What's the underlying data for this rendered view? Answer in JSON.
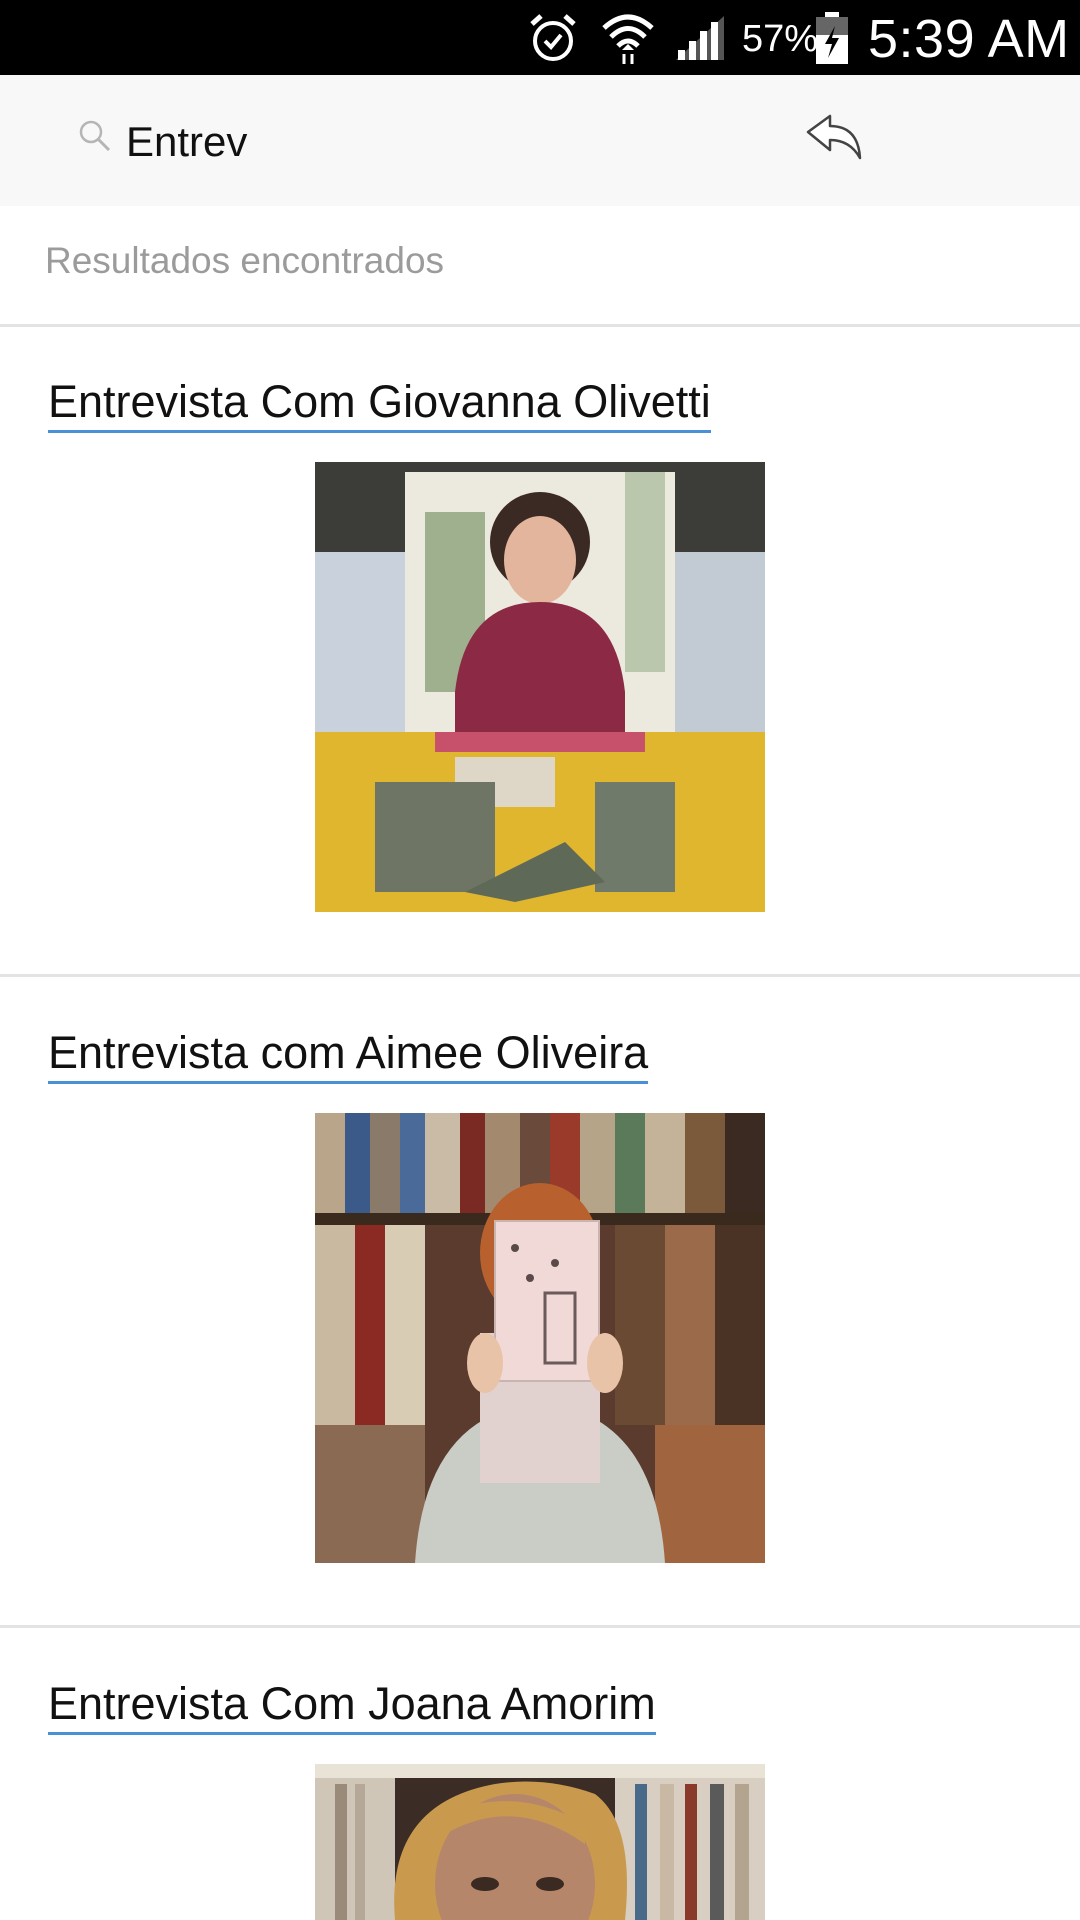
{
  "status_bar": {
    "battery_percent": "57%",
    "time": "5:39 AM",
    "icons": [
      "alarm-icon",
      "wifi-icon",
      "signal-icon",
      "battery-charging-icon"
    ]
  },
  "search": {
    "value": "Entrev",
    "icon": "search-icon",
    "back_icon": "reply-icon"
  },
  "results_label": "Resultados encontrados",
  "results": [
    {
      "title": "Entrevista Com Giovanna Olivetti",
      "image": "photo-woman-at-table-with-books"
    },
    {
      "title": "Entrevista com Aimee Oliveira",
      "image": "photo-woman-holding-book-bookshelves"
    },
    {
      "title": "Entrevista Com Joana Amorim",
      "image": "photo-woman-portrait-bookstore"
    }
  ],
  "colors": {
    "status_bar_bg": "#000000",
    "header_bg": "#f8f8f8",
    "link_underline": "#4a90d9",
    "muted_text": "#9b9b9b"
  }
}
